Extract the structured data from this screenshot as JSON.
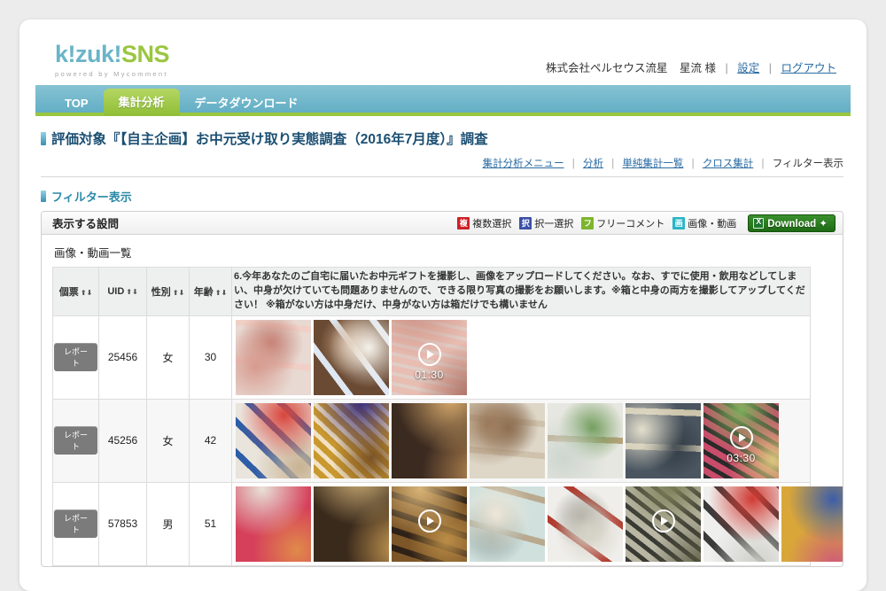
{
  "brand": {
    "name_k": "k!zuk!",
    "name_sns": "SNS",
    "tagline": "powered by Mycomment"
  },
  "header": {
    "company": "株式会社ペルセウス流星",
    "user": "星流 様",
    "settings_label": "設定",
    "logout_label": "ログアウト",
    "separator": "|"
  },
  "tabs": [
    {
      "label": "TOP",
      "active": false
    },
    {
      "label": "集計分析",
      "active": true
    },
    {
      "label": "データダウンロード",
      "active": false
    }
  ],
  "page": {
    "title": "評価対象『【自主企画】お中元受け取り実態調査（2016年7月度）』調査",
    "section_heading": "フィルター表示"
  },
  "crumbs": {
    "links": [
      "集計分析メニュー",
      "分析",
      "単純集計一覧",
      "クロス集計"
    ],
    "current": "フィルター表示",
    "separator": "|"
  },
  "panel": {
    "head_title": "表示する設問",
    "legend": [
      {
        "badge": "複",
        "label": "複数選択",
        "color": "#cc2127",
        "cls": "b-multi"
      },
      {
        "badge": "択",
        "label": "択一選択",
        "color": "#3b4fa8",
        "cls": "b-single"
      },
      {
        "badge": "フ",
        "label": "フリーコメント",
        "color": "#7db52c",
        "cls": "b-free"
      },
      {
        "badge": "画",
        "label": "画像・動画",
        "color": "#27b5c6",
        "cls": "b-media"
      }
    ],
    "download_label": "Download ✦",
    "list_title": "画像・動画一覧"
  },
  "table": {
    "columns": [
      {
        "label": "個票",
        "sortable": true
      },
      {
        "label": "UID",
        "sortable": true
      },
      {
        "label": "性別",
        "sortable": true
      },
      {
        "label": "年齢",
        "sortable": true
      }
    ],
    "question": "6.今年あなたのご自宅に届いたお中元ギフトを撮影し、画像をアップロードしてください。なお、すでに使用・飲用などしてしまい、中身が欠けていても問題ありませんので、できる限り写真の撮影をお願いします。※箱と中身の両方を撮影してアップしてください！ ※箱がない方は中身だけ、中身がない方は箱だけでも構いません",
    "report_label": "レポート",
    "rows": [
      {
        "uid": "25456",
        "sex": "女",
        "age": "30",
        "media": [
          {
            "type": "image",
            "desc": "packaged-ham-slices"
          },
          {
            "type": "image",
            "desc": "greeting-card-and-catalog"
          },
          {
            "type": "video",
            "duration": "01:30",
            "desc": "packaged-ham-slices-video"
          }
        ]
      },
      {
        "uid": "45256",
        "sex": "女",
        "age": "42",
        "media": [
          {
            "type": "image",
            "desc": "patterned-cloth-with-box"
          },
          {
            "type": "image",
            "desc": "cookies-assortment-box"
          },
          {
            "type": "image",
            "desc": "canned-drinks-rows"
          },
          {
            "type": "image",
            "desc": "wrapped-snack-packets"
          },
          {
            "type": "image",
            "desc": "tiled-floor-wrapped-sweets"
          },
          {
            "type": "image",
            "desc": "gift-box-with-wrapping-paper"
          },
          {
            "type": "video",
            "duration": "03:30",
            "desc": "opened-snack-gift-box-video"
          }
        ]
      },
      {
        "uid": "57853",
        "sex": "男",
        "age": "51",
        "media": [
          {
            "type": "image",
            "desc": "black-gift-box-with-fruit"
          },
          {
            "type": "image",
            "desc": "gold-beer-cans"
          },
          {
            "type": "video",
            "duration": "",
            "desc": "gold-beer-cans-video"
          },
          {
            "type": "image",
            "desc": "wrapped-gift-closeup"
          },
          {
            "type": "image",
            "desc": "white-packages-in-box"
          },
          {
            "type": "video",
            "duration": "",
            "desc": "melon-in-box-video"
          },
          {
            "type": "image",
            "desc": "red-lettered-wrapping"
          },
          {
            "type": "image",
            "desc": "assorted-jelly-sweets-tray"
          }
        ]
      }
    ]
  },
  "colors": {
    "tab_bar": "#63aec4",
    "tab_active": "#8fbe36",
    "accent_green": "#9ac63f",
    "title_blue": "#1b4f72",
    "link_blue": "#2b6ca3"
  }
}
